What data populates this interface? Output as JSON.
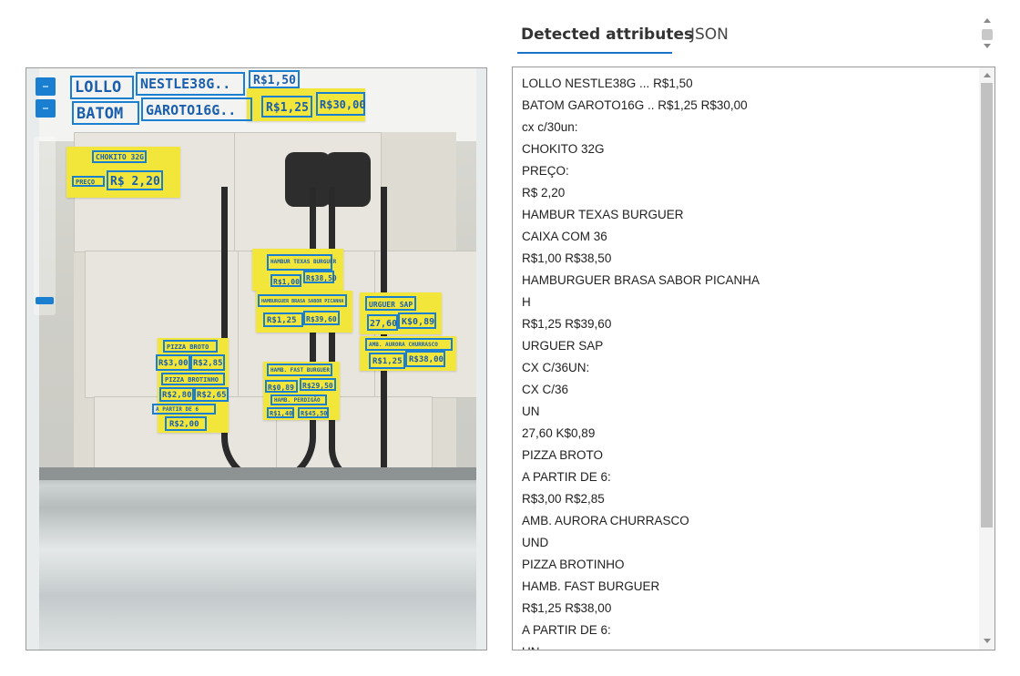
{
  "tabs": [
    {
      "label": "Detected attributes",
      "active": true
    },
    {
      "label": "JSON",
      "active": false
    }
  ],
  "detected_lines": [
    "LOLLO NESTLE38G ... R$1,50",
    "BATOM GAROTO16G .. R$1,25 R$30,00",
    "cx c/30un:",
    "CHOKITO 32G",
    "PREÇO:",
    "R$ 2,20",
    "HAMBUR TEXAS BURGUER",
    "CAIXA COM 36",
    "R$1,00 R$38,50",
    "HAMBURGUER BRASA SABOR PICANHA",
    "H",
    "R$1,25 R$39,60",
    "URGUER SAP",
    "CX C/36UN:",
    "CX C/36",
    "UN",
    "27,60 K$0,89",
    "PIZZA BROTO",
    "A PARTIR DE 6:",
    "R$3,00 R$2,85",
    "AMB. AURORA CHURRASCO",
    "UND",
    "PIZZA BROTINHO",
    "HAMB. FAST BURGUER",
    "R$1,25 R$38,00",
    "A PARTIR DE 6:",
    "UN"
  ],
  "image_labels": {
    "lollo": "LOLLO",
    "nestle": "NESTLE38G..",
    "price150": "R$1,50",
    "batom": "BATOM",
    "garoto": "GAROTO16G..",
    "price125": "R$1,25",
    "price3000": "R$30,00",
    "chokito": "CHOKITO 32G",
    "preco": "PREÇO",
    "price220": "R$ 2,20",
    "hamburtexas": "HAMBUR TEXAS BURGUER",
    "price100": "R$1,00",
    "price3850": "R$38,50",
    "hamburbrasa": "HAMBURGUER BRASA SABOR PICANHA",
    "price125b": "R$1,25",
    "price3960": "R$39,60",
    "urguer": "URGUER SAP",
    "price2760": "27,60",
    "price089": "K$0,89",
    "pizzabroto": "PIZZA BROTO",
    "price300": "R$3,00",
    "price285": "R$2,85",
    "pizzabrotinho": "PIZZA BROTINHO",
    "price280": "R$2,80",
    "price265": "R$2,65",
    "apartir": "A PARTIR DE 6",
    "price200": "R$2,00",
    "aurora": "AMB. AURORA CHURRASCO",
    "price125c": "R$1,25",
    "price3800": "R$38,00",
    "fastburguer": "HAMB. FAST BURGUER",
    "price089b": "R$0,89",
    "price2950": "R$29,50",
    "hambperdigao": "HAMB. PERDIGÃO",
    "price140": "R$1,40",
    "price4550": "R$45,50"
  },
  "colors": {
    "accent": "#1a73c8",
    "box": "#1a7fd1",
    "sticker": "#f3e63a"
  }
}
